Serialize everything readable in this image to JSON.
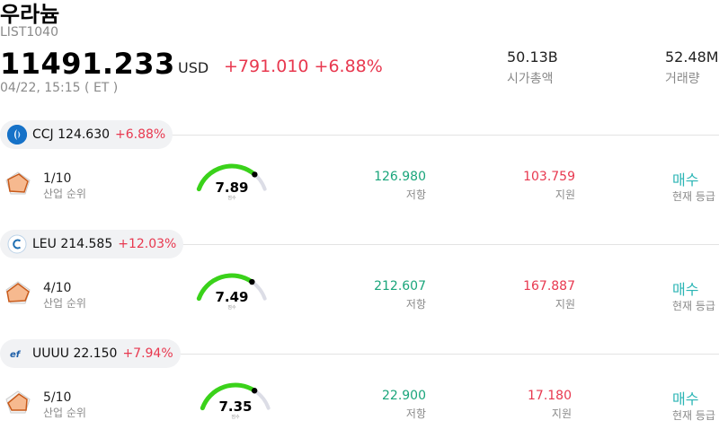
{
  "header": {
    "title": "우라늄",
    "code": "LIST1040",
    "price": "11491.233",
    "currency": "USD",
    "change": "+791.010 +6.88%",
    "time": "04/22, 15:15  ( ET )",
    "market_cap_value": "50.13B",
    "market_cap_label": "시가총액",
    "volume_value": "52.48M",
    "volume_label": "거래량"
  },
  "stocks": [
    {
      "ticker_price": "CCJ 124.630",
      "pct": "+6.88%",
      "logo_icon": "cameco-logo-icon",
      "rank": "1/10",
      "rank_label": "산업 순위",
      "score": "7.89",
      "score_fraction": 0.79,
      "score_label": "점수",
      "resistance": "126.980",
      "resistance_label": "저항",
      "support": "103.759",
      "support_label": "지원",
      "action": "매수",
      "action_label": "현재 등급"
    },
    {
      "ticker_price": "LEU 214.585",
      "pct": "+12.03%",
      "logo_icon": "centrus-logo-icon",
      "rank": "4/10",
      "rank_label": "산업 순위",
      "score": "7.49",
      "score_fraction": 0.75,
      "score_label": "점수",
      "resistance": "212.607",
      "resistance_label": "저항",
      "support": "167.887",
      "support_label": "지원",
      "action": "매수",
      "action_label": "현재 등급"
    },
    {
      "ticker_price": "UUUU 22.150",
      "pct": "+7.94%",
      "logo_icon": "energy-fuels-logo-icon",
      "rank": "5/10",
      "rank_label": "산업 순위",
      "score": "7.35",
      "score_fraction": 0.735,
      "score_label": "점수",
      "resistance": "22.900",
      "resistance_label": "저항",
      "support": "17.180",
      "support_label": "지원",
      "action": "매수",
      "action_label": "현재 등급"
    }
  ],
  "colors": {
    "up": "#e8384f",
    "resistance": "#1aa57b",
    "gauge_fill": "#3ad21a",
    "gauge_track": "#dcdde6",
    "buy": "#2bb5b5"
  }
}
